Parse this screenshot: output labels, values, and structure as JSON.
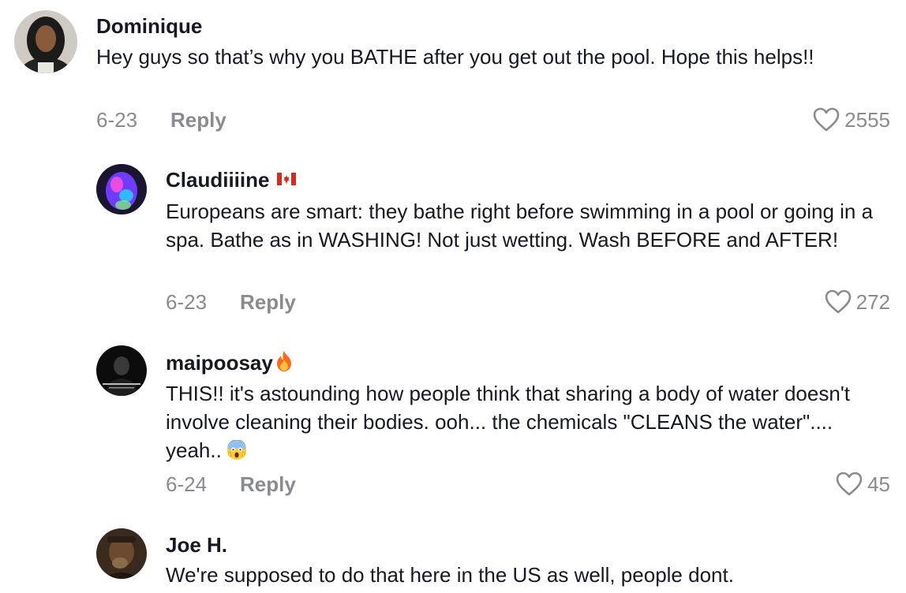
{
  "comments": [
    {
      "username": "Dominique",
      "text": "Hey guys so that’s why you BATHE after you get out the pool. Hope this helps!!",
      "date": "6-23",
      "reply_label": "Reply",
      "likes": "2555",
      "avatar_icon": "user-avatar-dominique"
    },
    {
      "username": "Claudiiiine",
      "badge_icon": "canada-flag-emoji",
      "text": "Europeans are smart: they bathe right before swimming in a pool or going in a spa. Bathe as in WASHING! Not just wetting. Wash BEFORE and AFTER!",
      "date": "6-23",
      "reply_label": "Reply",
      "likes": "272",
      "avatar_icon": "user-avatar-claudiiiine"
    },
    {
      "username": "maipoosay",
      "badge_icon": "fire-emoji",
      "text": "THIS!! it's astounding how people think that sharing a body of water doesn't involve cleaning their bodies. ooh... the chemicals \"CLEANS the water\".... yeah..",
      "trailing_emoji": "screaming-face-emoji",
      "date": "6-24",
      "reply_label": "Reply",
      "likes": "45",
      "avatar_icon": "user-avatar-maipoosay"
    },
    {
      "username": "Joe H.",
      "text": "We're supposed to do that here in the US as well, people dont.",
      "avatar_icon": "user-avatar-joe"
    }
  ],
  "colors": {
    "text": "#161823",
    "meta": "#8a8b91",
    "background": "#ffffff"
  },
  "icons": {
    "like": "heart-outline-icon"
  }
}
